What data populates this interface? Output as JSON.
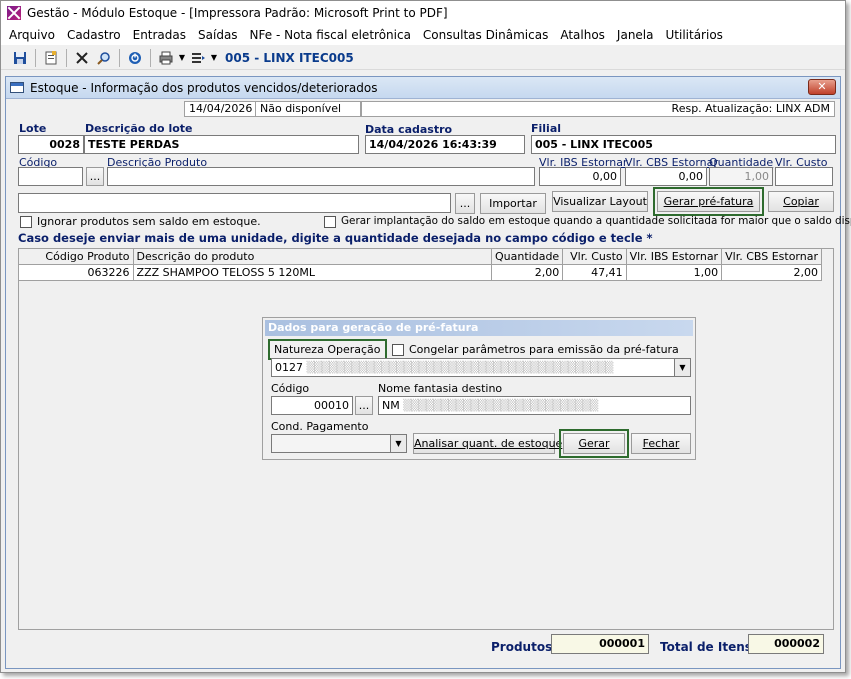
{
  "app": {
    "title": "Gestão  - Módulo Estoque - [Impressora Padrão: Microsoft Print to PDF]"
  },
  "menu": [
    "Arquivo",
    "Cadastro",
    "Entradas",
    "Saídas",
    "NFe - Nota fiscal eletrônica",
    "Consultas Dinâmicas",
    "Atalhos",
    "Janela",
    "Utilitários"
  ],
  "toolbar": {
    "store": "005 - LINX ITEC005"
  },
  "window": {
    "title": "Estoque - Informação dos produtos vencidos/deteriorados",
    "close": "✕",
    "status": {
      "date": "14/04/2026",
      "availability": "Não disponível",
      "resp": "Resp. Atualização: LINX ADM"
    }
  },
  "form": {
    "lote_label": "Lote",
    "lote_value": "0028",
    "descricao_lote_label": "Descrição do lote",
    "descricao_lote_value": "TESTE PERDAS",
    "data_cadastro_label": "Data cadastro",
    "data_cadastro_value": "14/04/2026 16:43:39",
    "filial_label": "Filial",
    "filial_value": "005 - LINX ITEC005",
    "codigo_label": "Código",
    "descricao_produto_label": "Descrição  Produto",
    "ibs_label": "Vlr. IBS Estornar",
    "ibs_value": "0,00",
    "cbs_label": "Vlr. CBS Estornar",
    "cbs_value": "0,00",
    "quantidade_label": "Quantidade",
    "quantidade_value": "1,00",
    "custo_label": "Vlr. Custo",
    "ellipsis": "...",
    "importar": "Importar",
    "visualizar_layout": "Visualizar Layout",
    "gerar_pre_fatura": "Gerar pré-fatura",
    "copiar": "Copiar",
    "ignorar_label": "Ignorar produtos sem saldo em estoque.",
    "gerar_implantacao_label": "Gerar implantação do saldo em estoque quando a quantidade solicitada for maior que o saldo disponível.",
    "hint": "Caso deseje enviar mais de uma unidade, digite a quantidade desejada no campo código e tecle *"
  },
  "table": {
    "headers": [
      "Código Produto",
      "Descrição do produto",
      "Quantidade",
      "Vlr. Custo",
      "Vlr. IBS Estornar",
      "Vlr. CBS Estornar"
    ],
    "rows": [
      [
        "063226",
        "ZZZ SHAMPOO TELOSS 5 120ML",
        "2,00",
        "47,41",
        "1,00",
        "2,00"
      ]
    ]
  },
  "dialog": {
    "title": "Dados para geração de pré-fatura",
    "natureza_label": "Natureza  Operação",
    "congelar_label": "Congelar parâmetros para emissão da pré-fatura",
    "natureza_value": "0127",
    "codigo_label": "Código",
    "codigo_value": "00010",
    "ellipsis": "...",
    "nome_fantasia_label": "Nome fantasia destino",
    "nome_fantasia_value": "NM",
    "cond_pagamento_label": "Cond. Pagamento",
    "analisar": "Analisar quant. de estoque",
    "gerar": "Gerar",
    "fechar": "Fechar"
  },
  "footer": {
    "produtos_label": "Produtos:",
    "produtos_value": "000001",
    "total_itens_label": "Total de Itens:",
    "total_itens_value": "000002"
  }
}
